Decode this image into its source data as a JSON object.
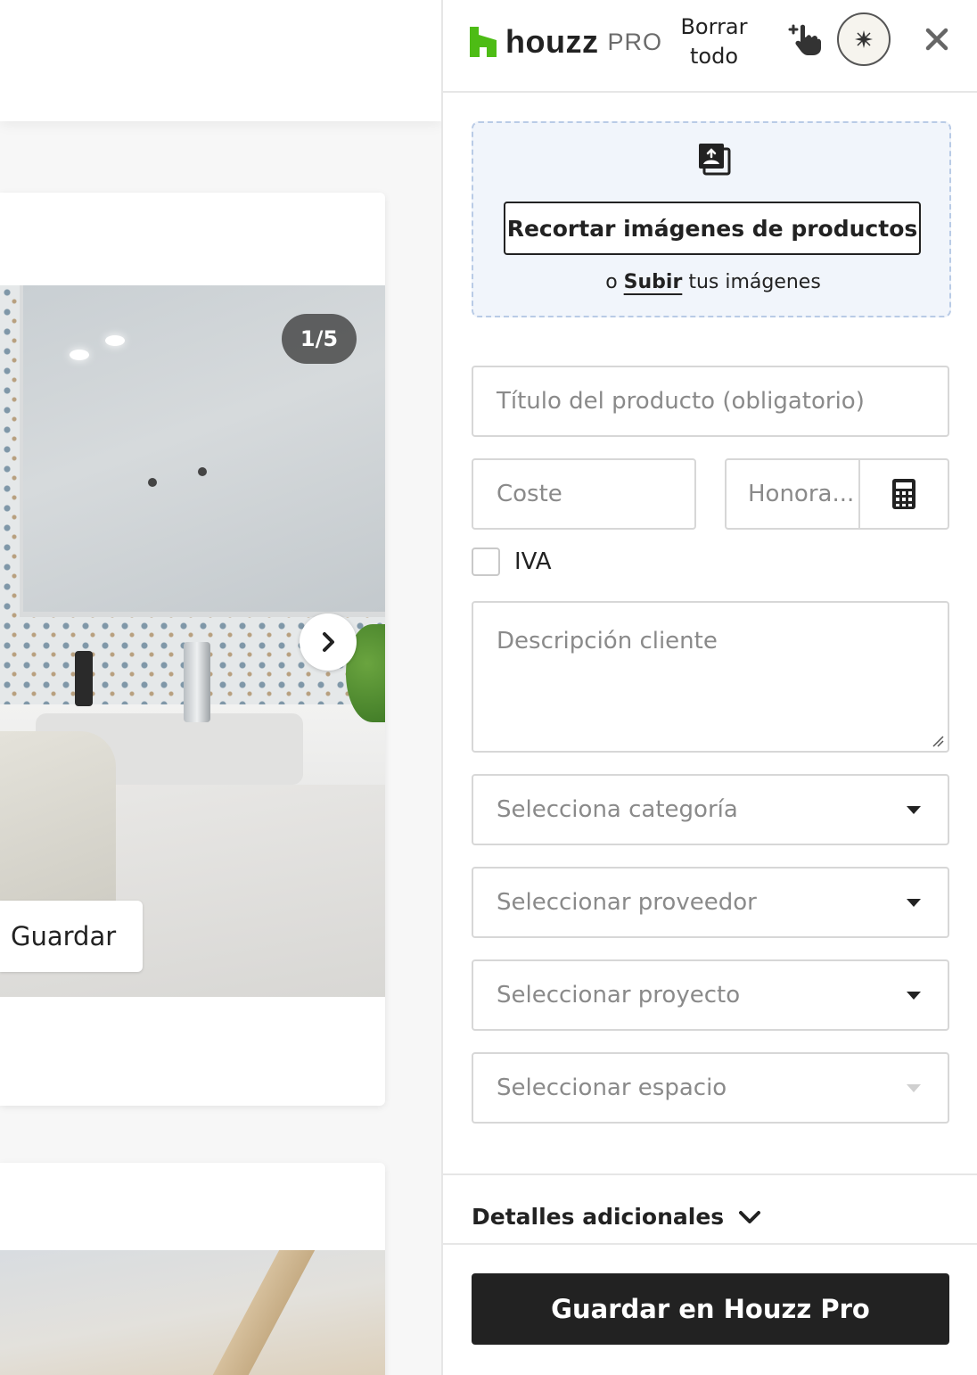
{
  "background_page": {
    "gallery": {
      "counter": "1/5",
      "next_label": "next",
      "save_label": "Guardar"
    }
  },
  "panel": {
    "brand": {
      "name": "houzz",
      "suffix": "PRO",
      "color": "#4dbc15"
    },
    "header": {
      "clear_all": "Borrar todo"
    },
    "icons": {
      "clip": "pointer-plus-icon",
      "assistant": "sparkle-icon",
      "close": "close-icon",
      "upload": "image-upload-icon",
      "calculator": "calculator-icon"
    },
    "upload": {
      "crop_button": "Recortar imágenes de productos",
      "prefix": "o",
      "link": "Subir",
      "suffix": "tus imágenes"
    },
    "form": {
      "title_placeholder": "Título del producto (obligatorio)",
      "cost_placeholder": "Coste",
      "fee_placeholder": "Honora...",
      "vat_label": "IVA",
      "vat_checked": false,
      "description_placeholder": "Descripción cliente",
      "category_placeholder": "Selecciona categoría",
      "vendor_placeholder": "Seleccionar proveedor",
      "project_placeholder": "Seleccionar proyecto",
      "room_placeholder": "Seleccionar espacio"
    },
    "details": {
      "label": "Detalles adicionales"
    },
    "primary_button": "Guardar en Houzz Pro"
  }
}
